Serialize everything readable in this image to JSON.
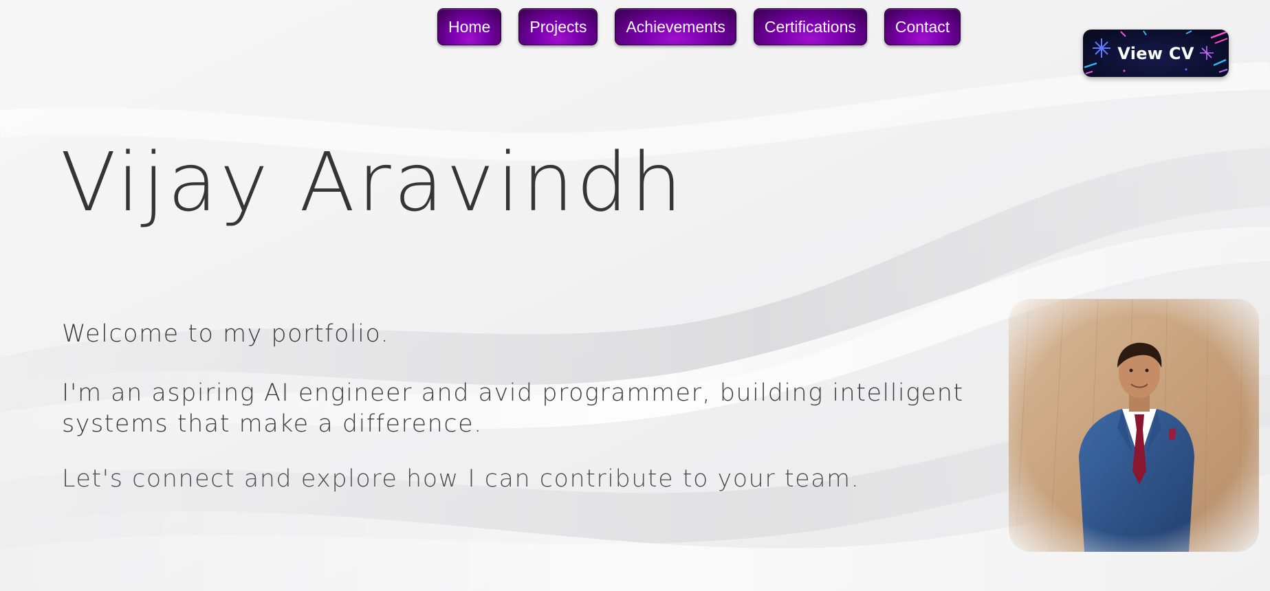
{
  "nav": {
    "items": [
      {
        "label": "Home"
      },
      {
        "label": "Projects"
      },
      {
        "label": "Achievements"
      },
      {
        "label": "Certifications"
      },
      {
        "label": "Contact"
      }
    ]
  },
  "cv_button": {
    "label": "View CV"
  },
  "hero": {
    "name": "Vijay Aravindh",
    "welcome": "Welcome to my portfolio.",
    "about": "I'm an aspiring AI engineer and avid programmer, building intelligent systems that make a difference.",
    "connect": "Let's connect and explore how I can contribute to your team."
  },
  "colors": {
    "nav_purple": "#7a00ad",
    "cv_navy": "#0c0f2e",
    "text_dark": "#353535",
    "background": "#f4f4f5"
  }
}
